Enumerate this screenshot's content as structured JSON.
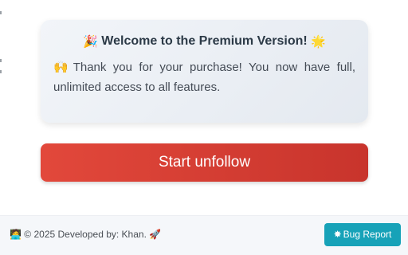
{
  "premium": {
    "title_icon_left": "🎉",
    "title": "Welcome to the Premium Version!",
    "title_icon_right": "🌟",
    "message_icon": "🙌",
    "message": "Thank you for your purchase! You now have full, unlimited access to all features."
  },
  "actions": {
    "start_unfollow_label": "Start unfollow"
  },
  "footer": {
    "credit_icon": "🧑‍💻",
    "credit_text": "© 2025 Developed by: Khan.",
    "credit_icon_right": "🚀",
    "bug_report_icon": "✸",
    "bug_report_label": "Bug Report"
  },
  "colors": {
    "accent_red": "#d93f34",
    "bug_button": "#17a2b8",
    "card_background": "#e8edf3"
  }
}
